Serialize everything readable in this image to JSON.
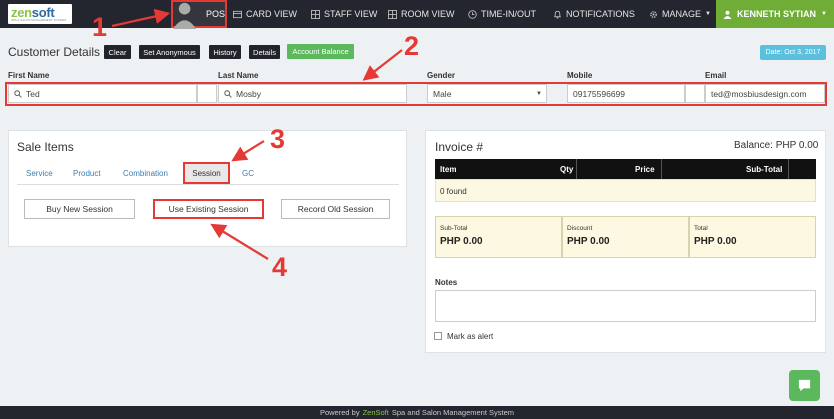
{
  "brand": {
    "logo_main": "zen",
    "logo_accent": "soft",
    "logo_tagline": "SPA & SALON MANAGEMENT SYSTEM"
  },
  "nav": {
    "pos": "POS",
    "card_view": "CARD VIEW",
    "staff_view": "STAFF VIEW",
    "room_view": "ROOM VIEW",
    "time_in_out": "TIME-IN/OUT",
    "notifications": "NOTIFICATIONS",
    "manage": "MANAGE",
    "user": "KENNETH SYTIAN"
  },
  "customer": {
    "title": "Customer Details",
    "buttons": {
      "clear": "Clear",
      "set_anonymous": "Set Anonymous",
      "history": "History",
      "details": "Details",
      "account_balance": "Account Balance"
    },
    "date": "Date: Oct 3, 2017",
    "labels": {
      "first_name": "First Name",
      "last_name": "Last Name",
      "gender": "Gender",
      "mobile": "Mobile",
      "email": "Email"
    },
    "values": {
      "first_name": "Ted",
      "last_name": "Mosby",
      "gender": "Male",
      "mobile": "09175596699",
      "email": "ted@mosbiusdesign.com"
    }
  },
  "sale_items": {
    "title": "Sale Items",
    "tabs": {
      "service": "Service",
      "product": "Product",
      "combination": "Combination",
      "session": "Session",
      "gc": "GC"
    },
    "actions": {
      "buy_new": "Buy New Session",
      "use_existing": "Use Existing Session",
      "record_old": "Record Old Session"
    }
  },
  "invoice": {
    "title": "Invoice #",
    "balance": "Balance: PHP 0.00",
    "columns": {
      "item": "Item",
      "qty": "Qty",
      "price": "Price",
      "subtotal": "Sub-Total"
    },
    "empty": "0 found",
    "totals": [
      {
        "label": "Sub-Total",
        "value": "PHP 0.00"
      },
      {
        "label": "Discount",
        "value": "PHP 0.00"
      },
      {
        "label": "Total",
        "value": "PHP 0.00"
      }
    ],
    "notes_label": "Notes",
    "mark_alert": "Mark as alert"
  },
  "footer": {
    "prefix": "Powered by",
    "brand": "ZenSoft",
    "suffix": "Spa and Salon Management System"
  },
  "annotations": {
    "n1": "1",
    "n2": "2",
    "n3": "3",
    "n4": "4"
  },
  "colors": {
    "accent_red": "#e53935",
    "brand_green": "#6fad37",
    "nav_dark": "#23252f",
    "info_blue": "#5bc0de"
  }
}
